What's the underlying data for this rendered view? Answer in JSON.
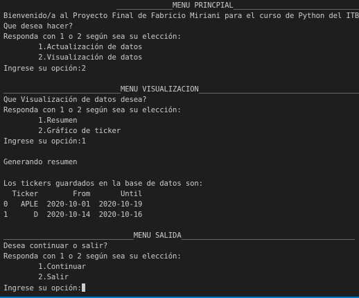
{
  "terminal": {
    "lines": [
      "                          _____________MENU PRINCPIAL_________________________________",
      "Bienvenido/a al Proyecto Final de Fabricio Miriani para el curso de Python del ITBA",
      "Que desea hacer?",
      "Responda con 1 o 2 según sea su elección:",
      "        1.Actualización de datos",
      "        2.Visualización de datos",
      "Ingrese su opción:2",
      "",
      "___________________________MENU VISUALIZACION_____________________________________",
      "Que Visualización de datos desea?",
      "Responda con 1 o 2 según sea su elección:",
      "        1.Resumen",
      "        2.Gráfico de ticker",
      "Ingrese su opción:1",
      "",
      "Generando resumen",
      "",
      "Los tickers guardados en la base de datos son:",
      "  Ticker        From       Until",
      "0   APLE  2020-10-01  2020-10-19",
      "1      D  2020-10-14  2020-10-16",
      "",
      "______________________________MENU SALIDA________________________________________",
      "Desea continuar o salir?",
      "Responda con 1 o 2 según sea su elección:",
      "        1.Continuar",
      "        2.Salir",
      "Ingrese su opción:"
    ]
  },
  "colors": {
    "background": "#1e1e1e",
    "text": "#cccccc",
    "cursor": "#cccccc",
    "accent": "#007acc"
  }
}
